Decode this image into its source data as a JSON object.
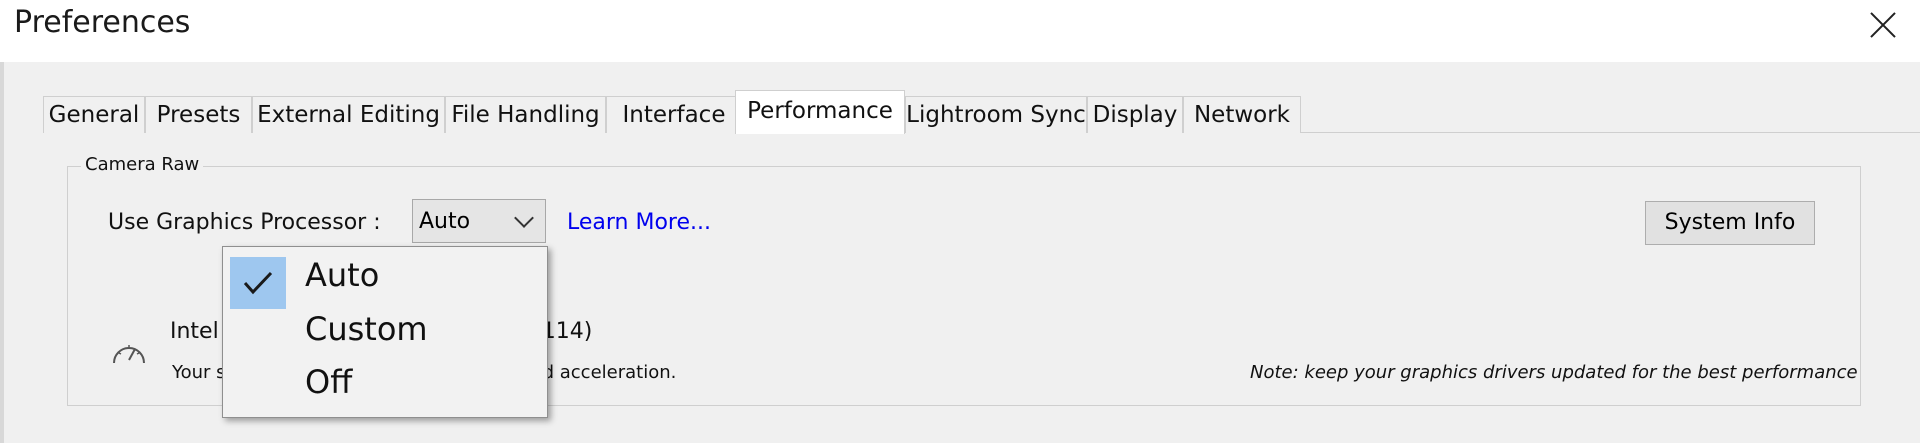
{
  "window": {
    "title": "Preferences"
  },
  "tabs": [
    {
      "label": "General"
    },
    {
      "label": "Presets"
    },
    {
      "label": "External Editing"
    },
    {
      "label": "File Handling"
    },
    {
      "label": "Interface"
    },
    {
      "label": "Performance",
      "active": true
    },
    {
      "label": "Lightroom Sync"
    },
    {
      "label": "Display"
    },
    {
      "label": "Network"
    }
  ],
  "camera_raw": {
    "group_label": "Camera Raw",
    "gp_label": "Use Graphics Processor :",
    "gp_value": "Auto",
    "gp_options": [
      {
        "label": "Auto",
        "checked": true
      },
      {
        "label": "Custom",
        "checked": false
      },
      {
        "label": "Off",
        "checked": false
      }
    ],
    "learn_more": "Learn More...",
    "system_info": "System Info",
    "gpu_name": "Intel",
    "gpu_name_tail": "114)",
    "gpu_status": "Your s",
    "gpu_status_tail": "ed acceleration.",
    "note": "Note: keep your graphics drivers updated for the best performance"
  },
  "colors": {
    "accent_link": "#0000ee",
    "menu_highlight": "#9ec7ef",
    "panel_bg": "#f0f0f0"
  },
  "icons": [
    "close-icon",
    "chevron-down-icon",
    "checkmark-icon",
    "gauge-icon"
  ]
}
